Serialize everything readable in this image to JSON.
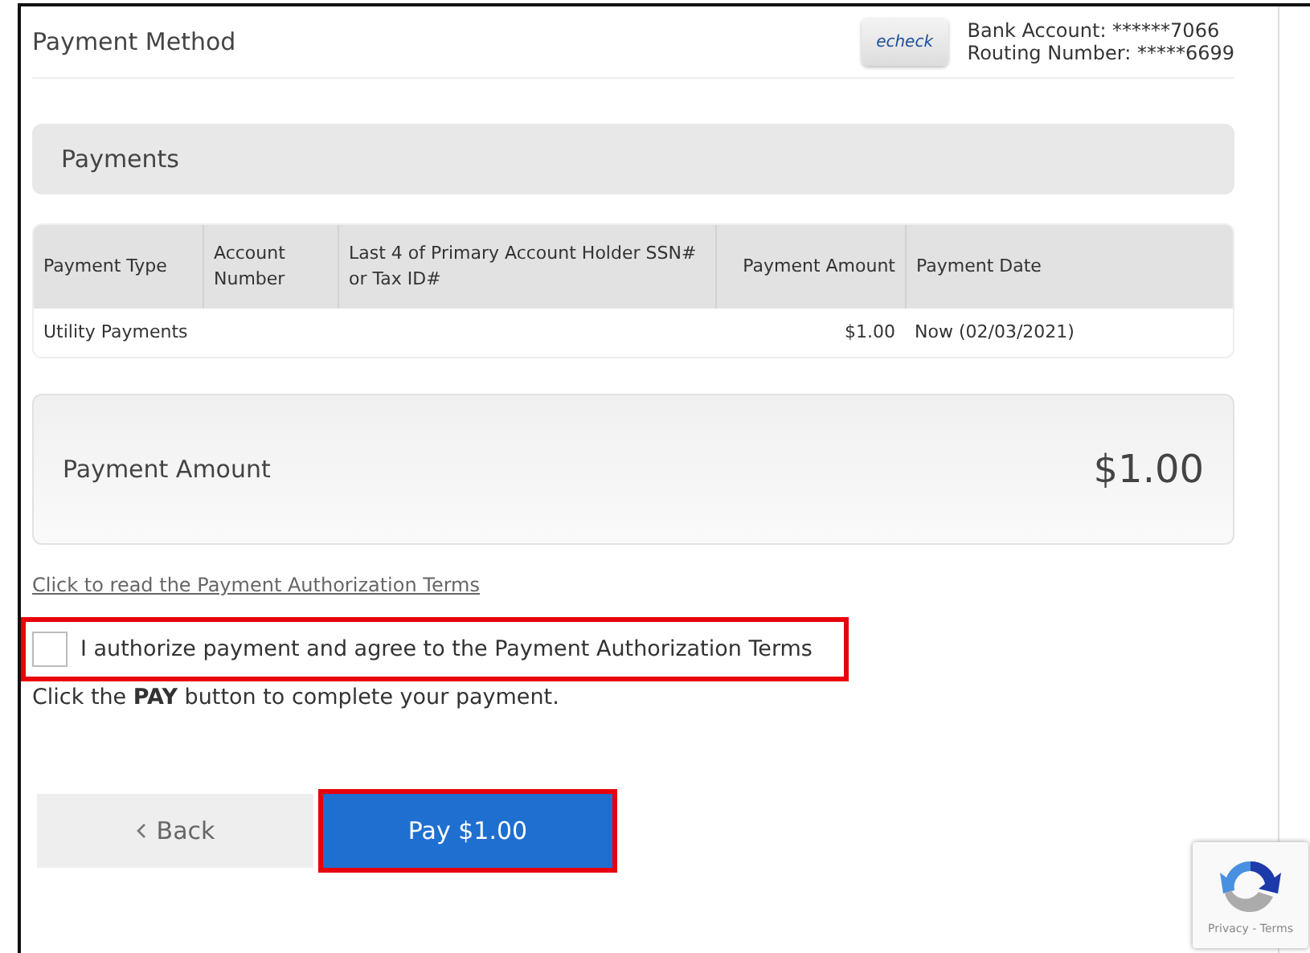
{
  "payment_method": {
    "title": "Payment Method",
    "logo_text": "echeck",
    "bank_account": "Bank Account: ******7066",
    "routing_number": "Routing Number: *****6699"
  },
  "payments": {
    "title": "Payments",
    "table": {
      "columns": [
        "Payment Type",
        "Account Number",
        "Last 4 of Primary Account Holder SSN# or Tax ID#",
        "Payment Amount",
        "Payment Date"
      ],
      "rows": [
        [
          "Utility Payments",
          "",
          "",
          "$1.00",
          "Now (02/03/2021)"
        ]
      ]
    }
  },
  "total": {
    "label": "Payment Amount",
    "value": "$1.00"
  },
  "terms_link": "Click to read the Payment Authorization Terms",
  "authorize": {
    "label": "I authorize payment and agree to the Payment Authorization Terms",
    "checked": false,
    "highlighted": true
  },
  "instruction": "Click the **PAY** button to complete your payment.",
  "buttons": [
    {
      "kind": "back",
      "label": "Back",
      "highlighted": false
    },
    {
      "kind": "pay",
      "label": "Pay $1.00",
      "highlighted": true
    }
  ],
  "recaptcha": {
    "links": "Privacy - Terms"
  }
}
